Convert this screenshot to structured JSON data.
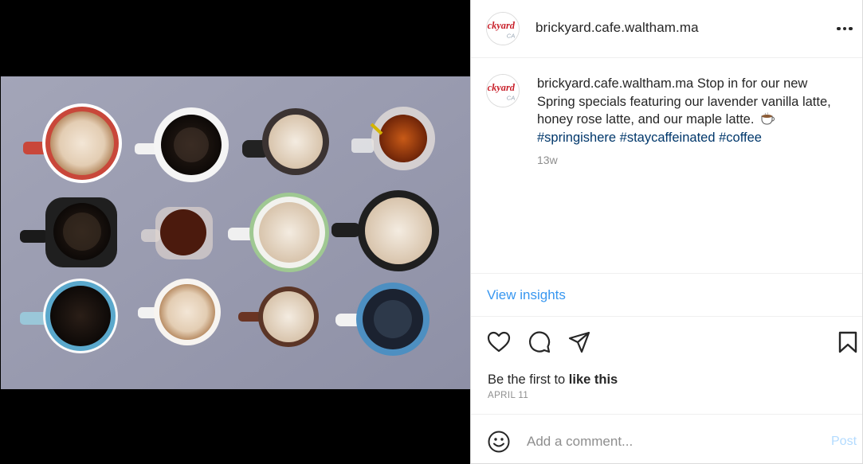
{
  "header": {
    "username": "brickyard.cafe.waltham.ma",
    "more_icon": "more-horizontal-icon"
  },
  "avatar": {
    "logo_text": "ickyard",
    "logo_sub": "CA",
    "logo_color": "#c8202a"
  },
  "caption": {
    "username": "brickyard.cafe.waltham.ma",
    "text": "Stop in for our new Spring specials featuring our lavender vanilla latte, honey rose latte, and our maple latte.",
    "emoji": "coffee-emoji",
    "hashtags": "#springishere #staycaffeinated #coffee",
    "time_ago": "13w"
  },
  "insights": {
    "label": "View insights"
  },
  "actions": {
    "like_icon": "heart-icon",
    "comment_icon": "comment-icon",
    "share_icon": "paper-plane-icon",
    "save_icon": "bookmark-icon"
  },
  "likes": {
    "prefix": "Be the first to ",
    "action": "like this"
  },
  "date": "APRIL 11",
  "comment": {
    "emoji_icon": "smiley-icon",
    "placeholder": "Add a comment...",
    "post_label": "Post"
  },
  "colors": {
    "link_blue": "#3897f0",
    "hashtag_blue": "#00376b",
    "muted_gray": "#8e8e8e",
    "post_disabled": "#b3dbff"
  }
}
